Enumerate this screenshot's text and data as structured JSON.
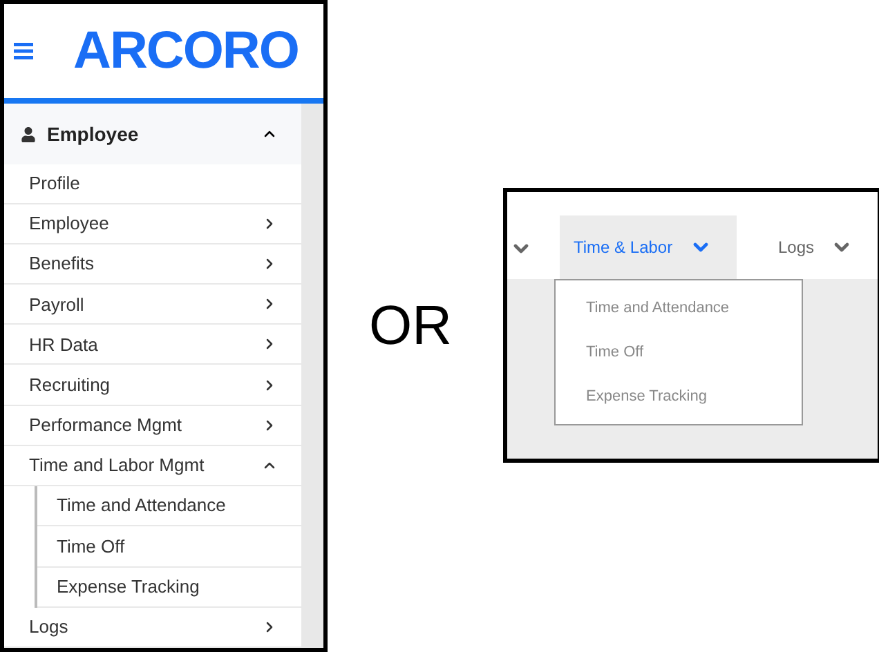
{
  "logo": {
    "text": "ARCORO"
  },
  "sidebar": {
    "section": {
      "label": "Employee",
      "expanded": true
    },
    "items": [
      {
        "label": "Profile",
        "kind": "link"
      },
      {
        "label": "Employee",
        "kind": "submenu",
        "expanded": false
      },
      {
        "label": "Benefits",
        "kind": "submenu",
        "expanded": false
      },
      {
        "label": "Payroll",
        "kind": "submenu",
        "expanded": false
      },
      {
        "label": "HR Data",
        "kind": "submenu",
        "expanded": false
      },
      {
        "label": "Recruiting",
        "kind": "submenu",
        "expanded": false
      },
      {
        "label": "Performance Mgmt",
        "kind": "submenu",
        "expanded": false
      },
      {
        "label": "Time and Labor Mgmt",
        "kind": "submenu",
        "expanded": true,
        "children": [
          {
            "label": "Time and Attendance"
          },
          {
            "label": "Time Off"
          },
          {
            "label": "Expense Tracking"
          }
        ]
      },
      {
        "label": "Logs",
        "kind": "submenu",
        "expanded": false
      }
    ]
  },
  "separator": "OR",
  "topnav": {
    "items": [
      {
        "kind": "cut"
      },
      {
        "kind": "menu",
        "label": "Time & Labor",
        "selected": true
      },
      {
        "kind": "menu",
        "label": "Logs",
        "selected": false
      }
    ],
    "dropdown": {
      "items": [
        {
          "label": "Time and Attendance"
        },
        {
          "label": "Time Off"
        },
        {
          "label": "Expense Tracking"
        }
      ]
    }
  }
}
